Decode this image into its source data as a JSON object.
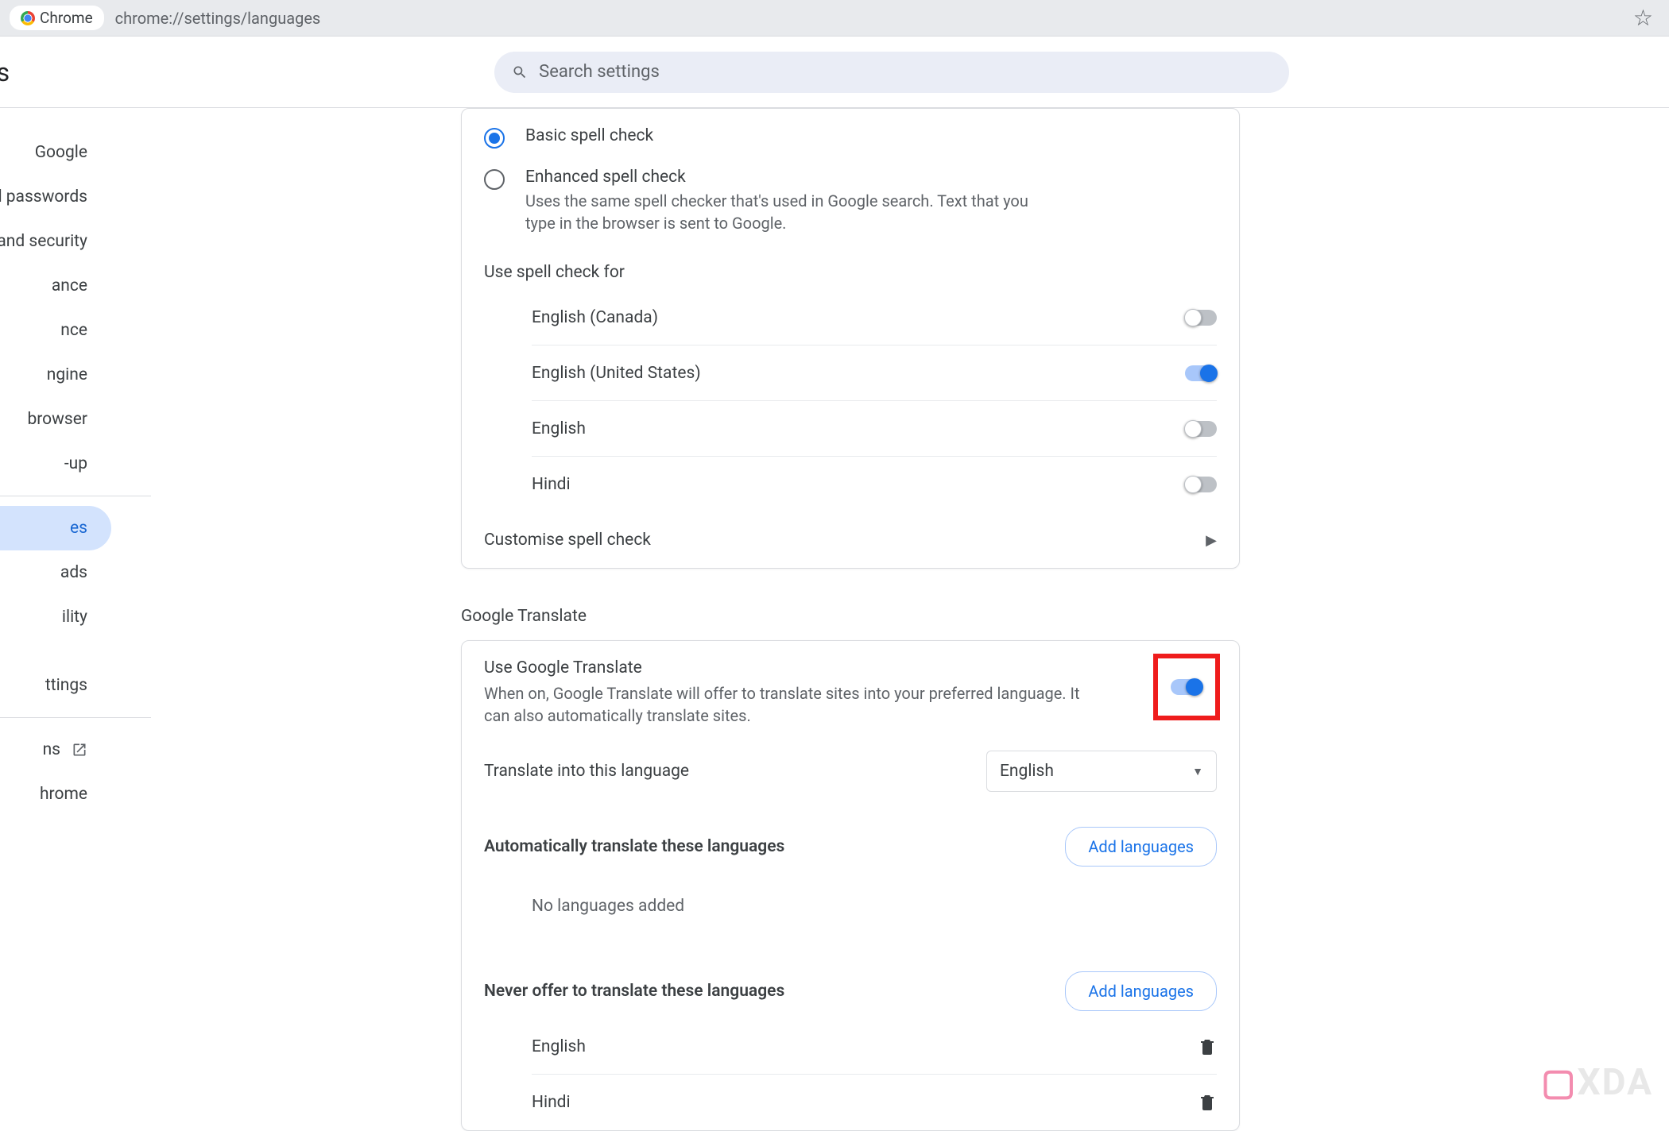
{
  "address": {
    "chip": "Chrome",
    "url": "chrome://settings/languages"
  },
  "header": {
    "title": "ngs",
    "search_placeholder": "Search settings"
  },
  "sidebar": {
    "items": [
      "Google",
      "and passwords",
      "and security",
      "ance",
      "nce",
      "ngine",
      "browser",
      "-up",
      "es",
      "ads",
      "ility"
    ],
    "reset": "ttings",
    "extensions": "ns",
    "about": "hrome"
  },
  "spellcheck": {
    "basic": "Basic spell check",
    "enhanced": "Enhanced spell check",
    "enhanced_desc": "Uses the same spell checker that's used in Google search. Text that you type in the browser is sent to Google.",
    "use_for": "Use spell check for",
    "languages": [
      {
        "name": "English (Canada)",
        "on": false
      },
      {
        "name": "English (United States)",
        "on": true
      },
      {
        "name": "English",
        "on": false
      },
      {
        "name": "Hindi",
        "on": false
      }
    ],
    "customise": "Customise spell check"
  },
  "translate": {
    "section": "Google Translate",
    "use_title": "Use Google Translate",
    "use_desc": "When on, Google Translate will offer to translate sites into your preferred language. It can also automatically translate sites.",
    "trans_into": "Translate into this language",
    "trans_lang": "English",
    "auto_title": "Automatically translate these languages",
    "add_btn": "Add languages",
    "no_lang": "No languages added",
    "never_title": "Never offer to translate these languages",
    "never_list": [
      "English",
      "Hindi"
    ]
  },
  "watermark": {
    "brand": "XDA"
  }
}
